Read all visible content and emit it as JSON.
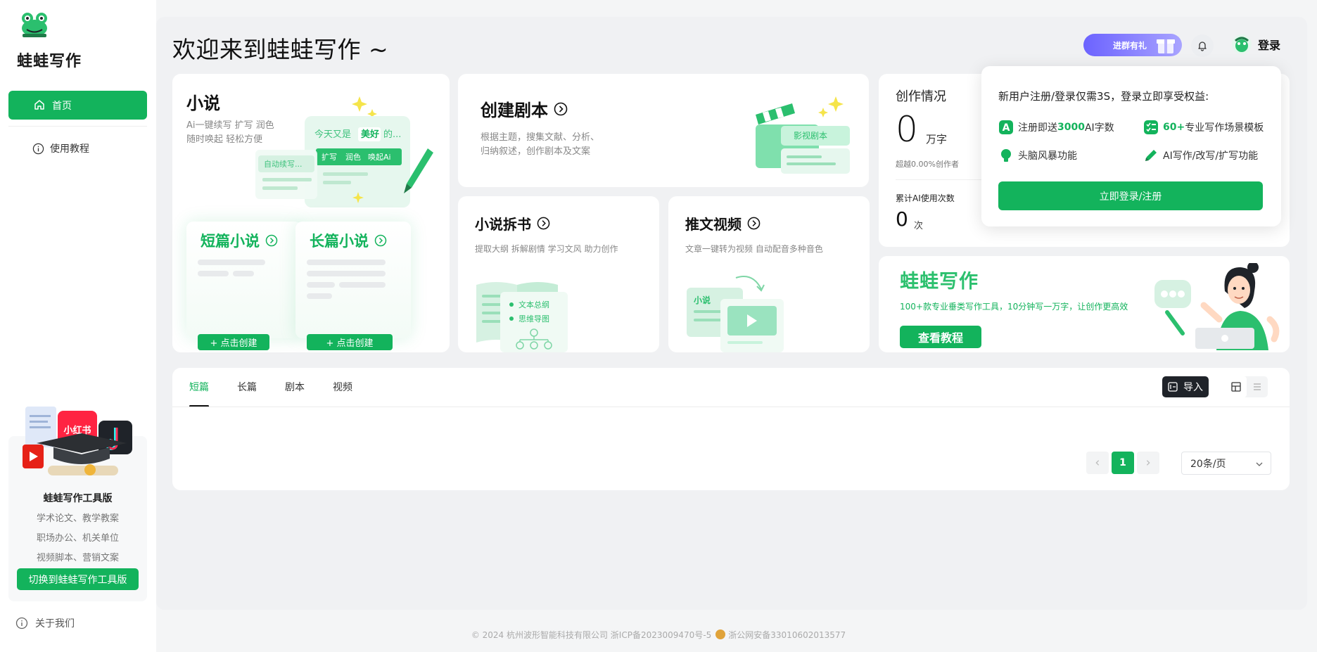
{
  "app": {
    "name": "蛙蛙写作"
  },
  "sidebar": {
    "items": [
      {
        "label": "首页",
        "active": true
      },
      {
        "label": "使用教程"
      }
    ],
    "promo": {
      "badge": "小红书",
      "title": "蛙蛙写作工具版",
      "lines": [
        "学术论文、教学教案",
        "职场办公、机关单位",
        "视频脚本、营销文案"
      ],
      "button": "切换到蛙蛙写作工具版"
    },
    "about": "关于我们"
  },
  "header": {
    "welcome": "欢迎来到蛙蛙写作 ~",
    "group_button": "进群有礼",
    "login": "登录"
  },
  "novel": {
    "title": "小说",
    "sub1": "Ai一键续写 扩写 润色",
    "sub2": "随时唤起 轻松方便",
    "art": {
      "chip_auto": "自动续写...",
      "bubble_prefix": "今天又是",
      "bubble_highlight": "美好",
      "bubble_suffix": "的...",
      "tools": [
        "扩写",
        "润色",
        "唤起Ai"
      ]
    },
    "short": {
      "title": "短篇小说",
      "button": "+ 点击创建"
    },
    "long": {
      "title": "长篇小说",
      "button": "+ 点击创建"
    }
  },
  "script": {
    "title": "创建剧本",
    "desc1": "根据主题，搜集文献、分析、",
    "desc2": "归纳叙述，创作剧本及文案",
    "art_label": "影视剧本"
  },
  "split": {
    "title": "小说拆书",
    "desc": "提取大纲 拆解剧情 学习文风 助力创作",
    "art_items": [
      "文本总纲",
      "思维导图"
    ]
  },
  "video": {
    "title": "推文视频",
    "desc": "文章一键转为视频 自动配音多种音色",
    "art_label": "小说"
  },
  "stats": {
    "title": "创作情况",
    "words_value": "0",
    "words_unit": "万字",
    "beat_note": "超越0.00%创作者",
    "ai_label": "累计AI使用次数",
    "ai_value": "0",
    "ai_unit": "次"
  },
  "brand": {
    "title": "蛙蛙写作",
    "desc": "100+款专业垂类写作工具，10分钟写一万字，让创作更高效",
    "button": "查看教程"
  },
  "popover": {
    "title": "新用户注册/登录仅需3S，登录立即享受权益:",
    "perks": [
      {
        "pre": "注册即送",
        "hl": "3000",
        "post": "AI字数"
      },
      {
        "pre": "",
        "hl": "60+",
        "post": "专业写作场景模板"
      },
      {
        "pre": "头脑风暴功能",
        "hl": "",
        "post": ""
      },
      {
        "pre": "AI写作/改写/扩写功能",
        "hl": "",
        "post": ""
      }
    ],
    "button": "立即登录/注册"
  },
  "works": {
    "tabs": [
      "短篇",
      "长篇",
      "剧本",
      "视频"
    ],
    "active_tab": 0,
    "import": "导入",
    "page": "1",
    "page_size": "20条/页"
  },
  "footer": {
    "copyright": "© 2024 杭州波形智能科技有限公司 浙ICP备2023009470号-5",
    "police": "浙公网安备33010602013577"
  },
  "colors": {
    "brand": "#13b35c",
    "accent_purple": "#6c63ff"
  }
}
